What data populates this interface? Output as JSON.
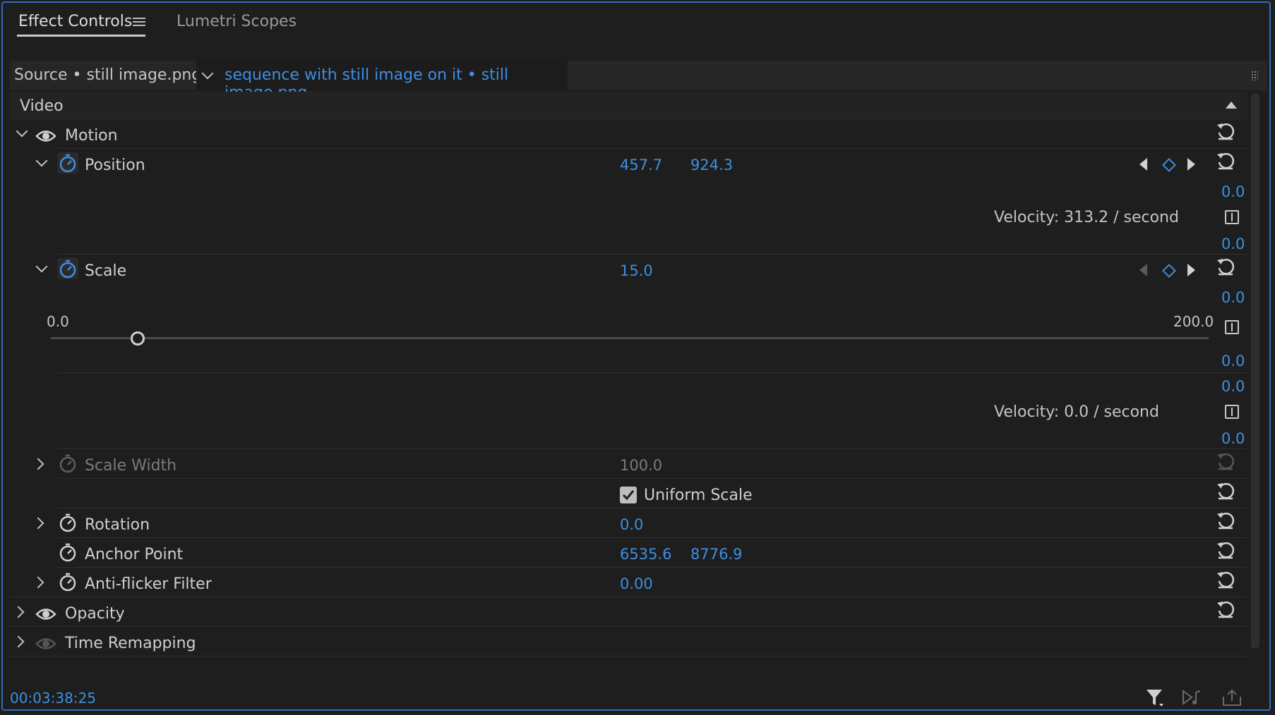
{
  "tabs": {
    "effect_controls": "Effect Controls",
    "lumetri_scopes": "Lumetri Scopes"
  },
  "source": {
    "left_label": "Source • still image.png",
    "sequence_label": "sequence with still image on it • still image.png"
  },
  "section": {
    "video": "Video"
  },
  "motion": {
    "label": "Motion",
    "position": {
      "label": "Position",
      "x": "457.7",
      "y": "924.3",
      "top_value": "0.0",
      "velocity": "Velocity: 313.2 / second",
      "bottom_value": "0.0"
    },
    "scale": {
      "label": "Scale",
      "value": "15.0",
      "value_right": "0.0",
      "slider_min": "0.0",
      "slider_max": "200.0",
      "slider_value": 15.0,
      "graph_value_1": "0.0",
      "graph_value_2": "0.0",
      "velocity": "Velocity: 0.0 / second",
      "graph_value_3": "0.0"
    },
    "scale_width": {
      "label": "Scale Width",
      "value": "100.0"
    },
    "uniform_scale": {
      "label": "Uniform Scale",
      "checked": true
    },
    "rotation": {
      "label": "Rotation",
      "value": "0.0"
    },
    "anchor_point": {
      "label": "Anchor Point",
      "x": "6535.6",
      "y": "8776.9"
    },
    "anti_flicker": {
      "label": "Anti-flicker Filter",
      "value": "0.00"
    }
  },
  "opacity": {
    "label": "Opacity"
  },
  "time_remapping": {
    "label": "Time Remapping"
  },
  "footer": {
    "timecode": "00:03:38:25"
  },
  "colors": {
    "accent_blue": "#3d8fe0",
    "frame_blue": "#2d6fb8",
    "panel_bg": "#1e1e1e"
  }
}
